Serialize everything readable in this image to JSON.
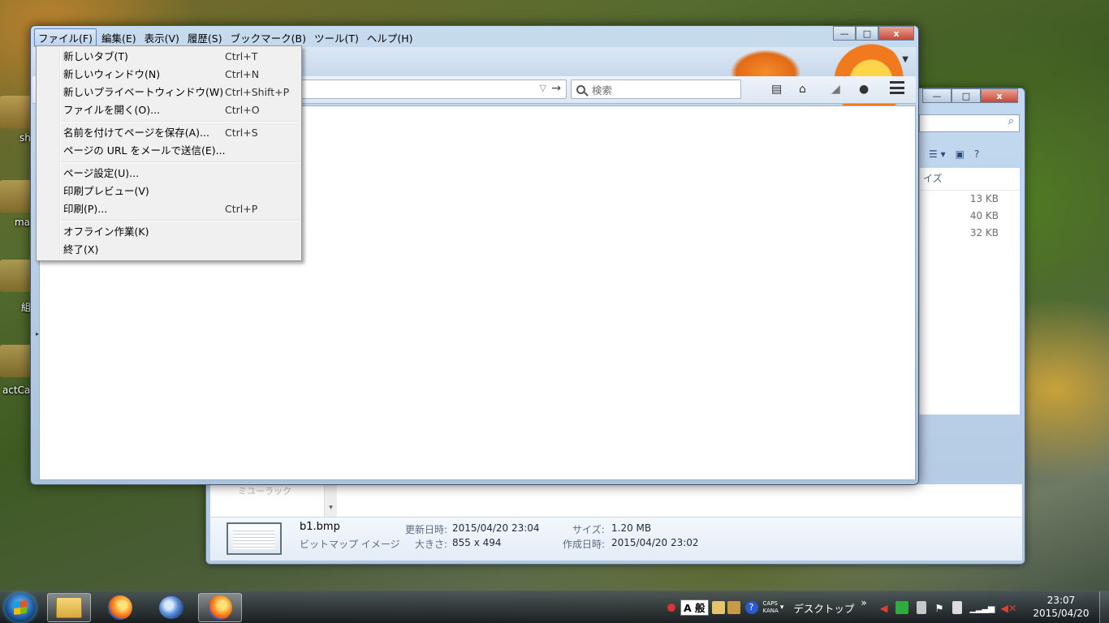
{
  "desktop": {
    "icons": [
      {
        "label": "sh"
      },
      {
        "label": "ma"
      },
      {
        "label": "組"
      },
      {
        "label": "actCa"
      }
    ]
  },
  "explorer": {
    "search_icon": "search-icon",
    "column_header": "イズ",
    "sizes": [
      "13 KB",
      "40 KB",
      "32 KB"
    ],
    "nav_partial": "ミユーラック",
    "details": {
      "file_name": "b1.bmp",
      "file_type": "ビットマップ イメージ",
      "modified_label": "更新日時:",
      "modified_value": "2015/04/20 23:04",
      "dimensions_label": "大きさ:",
      "dimensions_value": "855 x 494",
      "size_label": "サイズ:",
      "size_value": "1.20 MB",
      "created_label": "作成日時:",
      "created_value": "2015/04/20 23:02"
    }
  },
  "firefox": {
    "menubar": [
      {
        "label": "ファイル(F)",
        "active": true
      },
      {
        "label": "編集(E)"
      },
      {
        "label": "表示(V)"
      },
      {
        "label": "履歴(S)"
      },
      {
        "label": "ブックマーク(B)"
      },
      {
        "label": "ツール(T)"
      },
      {
        "label": "ヘルプ(H)"
      }
    ],
    "search_placeholder": "検索",
    "file_menu": [
      {
        "label": "新しいタブ(T)",
        "shortcut": "Ctrl+T"
      },
      {
        "label": "新しいウィンドウ(N)",
        "shortcut": "Ctrl+N"
      },
      {
        "label": "新しいプライベートウィンドウ(W)",
        "shortcut": "Ctrl+Shift+P"
      },
      {
        "label": "ファイルを開く(O)...",
        "shortcut": "Ctrl+O"
      },
      {
        "label": "名前を付けてページを保存(A)...",
        "shortcut": "Ctrl+S"
      },
      {
        "label": "ページの URL をメールで送信(E)...",
        "shortcut": ""
      },
      {
        "label": "ページ設定(U)...",
        "shortcut": ""
      },
      {
        "label": "印刷プレビュー(V)",
        "shortcut": ""
      },
      {
        "label": "印刷(P)...",
        "shortcut": "Ctrl+P"
      },
      {
        "label": "オフライン作業(K)",
        "shortcut": ""
      },
      {
        "label": "終了(X)",
        "shortcut": ""
      }
    ]
  },
  "taskbar": {
    "ime_mode": "A 般",
    "caps": "CAPS",
    "kana": "KANA",
    "toolbar_label": "デスクトップ",
    "toolbar_chevron": "»",
    "time": "23:07",
    "date": "2015/04/20"
  },
  "window_controls": {
    "minimize": "—",
    "maximize": "□",
    "close": "x"
  }
}
